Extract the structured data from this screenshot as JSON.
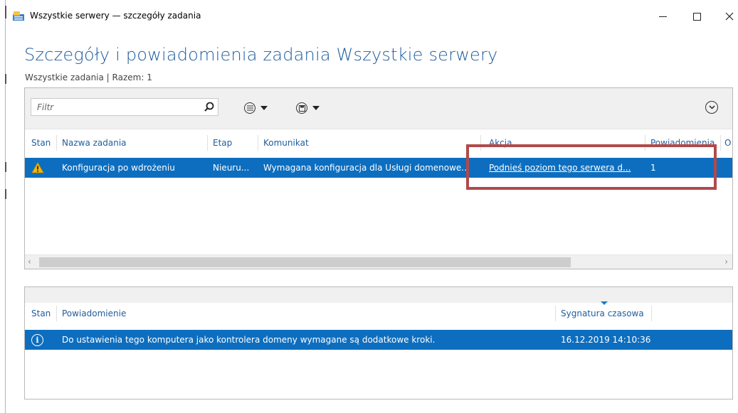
{
  "window": {
    "title": "Wszystkie serwery — szczegóły zadania",
    "controls": {
      "minimize": "minimize",
      "maximize": "maximize",
      "close": "close"
    }
  },
  "header": {
    "title": "Szczegóły i powiadomienia zadania Wszystkie serwery",
    "subtitle": "Wszystkie zadania | Razem: 1"
  },
  "tasks_panel": {
    "filter_placeholder": "Filtr",
    "columns": [
      "Stan",
      "Nazwa zadania",
      "Etap",
      "Komunikat",
      "Akcja",
      "Powiadomienia",
      "O"
    ],
    "rows": [
      {
        "status_icon": "warning-icon",
        "name": "Konfiguracja po wdrożeniu",
        "stage": "Nieuru...",
        "message": "Wymagana konfiguracja dla Usługi domenowe...",
        "action": "Podnieś poziom tego serwera d...",
        "notifications": "1"
      }
    ]
  },
  "notifications_panel": {
    "columns": [
      "Stan",
      "Powiadomienie",
      "Sygnatura czasowa"
    ],
    "rows": [
      {
        "status_icon": "info-icon",
        "text": "Do ustawienia tego komputera jako kontrolera domeny wymagane są dodatkowe kroki.",
        "timestamp": "16.12.2019 14:10:36"
      }
    ]
  },
  "colors": {
    "accent": "#1e5d9e",
    "selection": "#0d6ebf",
    "highlight": "#b04a4a",
    "warning": "#f2b705"
  }
}
